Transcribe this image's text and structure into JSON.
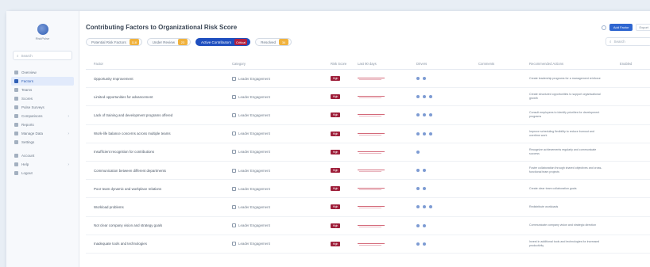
{
  "app": {
    "logo_text": "RiskPulse"
  },
  "sidebar": {
    "search_placeholder": "Search",
    "items": [
      {
        "label": "Overview",
        "active": false,
        "chevron": false
      },
      {
        "label": "Factors",
        "active": true,
        "chevron": false
      },
      {
        "label": "Teams",
        "active": false,
        "chevron": false
      },
      {
        "label": "Scores",
        "active": false,
        "chevron": false
      },
      {
        "label": "Pulse Surveys",
        "active": false,
        "chevron": false
      },
      {
        "label": "Comparisons",
        "active": false,
        "chevron": true
      },
      {
        "label": "Reports",
        "active": false,
        "chevron": false
      },
      {
        "label": "Manage Data",
        "active": false,
        "chevron": true
      },
      {
        "label": "Settings",
        "active": false,
        "chevron": false
      },
      {
        "label": "Account",
        "active": false,
        "chevron": false
      },
      {
        "label": "Help",
        "active": false,
        "chevron": true
      },
      {
        "label": "Logout",
        "active": false,
        "chevron": false
      }
    ]
  },
  "header": {
    "title": "Contributing Factors to Organizational Risk Score",
    "btn_primary": "Add Factor",
    "btn_secondary": "Export",
    "search_placeholder": "Search"
  },
  "chips": [
    {
      "label": "Potential Risk Factors",
      "count": "118",
      "active": false
    },
    {
      "label": "Under Review",
      "count": "23",
      "active": false
    },
    {
      "label": "Active Contributors",
      "count": "Critical",
      "active": true
    },
    {
      "label": "Resolved",
      "count": "34",
      "active": false
    }
  ],
  "table": {
    "columns": [
      "Factor",
      "Category",
      "Risk Score",
      "Last 90 days",
      "Drivers",
      "Comments",
      "Recommended Actions",
      "Enabled"
    ],
    "rows": [
      {
        "factor": "Opportunity Improvement",
        "category": "Leader Engagement",
        "risk": "High",
        "drivers": 2,
        "rec": "Create leadership programs for a management reinforce"
      },
      {
        "factor": "Limited opportunities for advancement",
        "category": "Leader Engagement",
        "risk": "High",
        "drivers": 3,
        "rec": "Create structured opportunities to support organisational growth"
      },
      {
        "factor": "Lack of training and development programs offered",
        "category": "Leader Engagement",
        "risk": "High",
        "drivers": 3,
        "rec": "Consult employees to identify priorities for development programs"
      },
      {
        "factor": "Work-life balance concerns across multiple teams",
        "category": "Leader Engagement",
        "risk": "High",
        "drivers": 3,
        "rec": "Improve scheduling flexibility to reduce burnout and overtime work"
      },
      {
        "factor": "Insufficient recognition for contributions",
        "category": "Leader Engagement",
        "risk": "High",
        "drivers": 1,
        "rec": "Recognize achievements regularly and communicate success"
      },
      {
        "factor": "Communication between different departments",
        "category": "Leader Engagement",
        "risk": "High",
        "drivers": 2,
        "rec": "Foster collaboration through shared objectives and cross-functional team projects"
      },
      {
        "factor": "Poor team dynamic and workplace relations",
        "category": "Leader Engagement",
        "risk": "High",
        "drivers": 2,
        "rec": "Create clear team collaboration goals"
      },
      {
        "factor": "Workload problems",
        "category": "Leader Engagement",
        "risk": "High",
        "drivers": 3,
        "rec": "Redistribute workloads"
      },
      {
        "factor": "Not clear company vision and strategy goals",
        "category": "Leader Engagement",
        "risk": "High",
        "drivers": 2,
        "rec": "Communicate company vision and strategic direction"
      },
      {
        "factor": "Inadequate tools and technologies",
        "category": "Leader Engagement",
        "risk": "High",
        "drivers": 2,
        "rec": "Invest in additional tools and technologies for increased productivity"
      }
    ]
  },
  "colors": {
    "accent": "#1f4fbf",
    "risk_high": "#9e1f3a",
    "count_badge": "#f0b23e"
  }
}
